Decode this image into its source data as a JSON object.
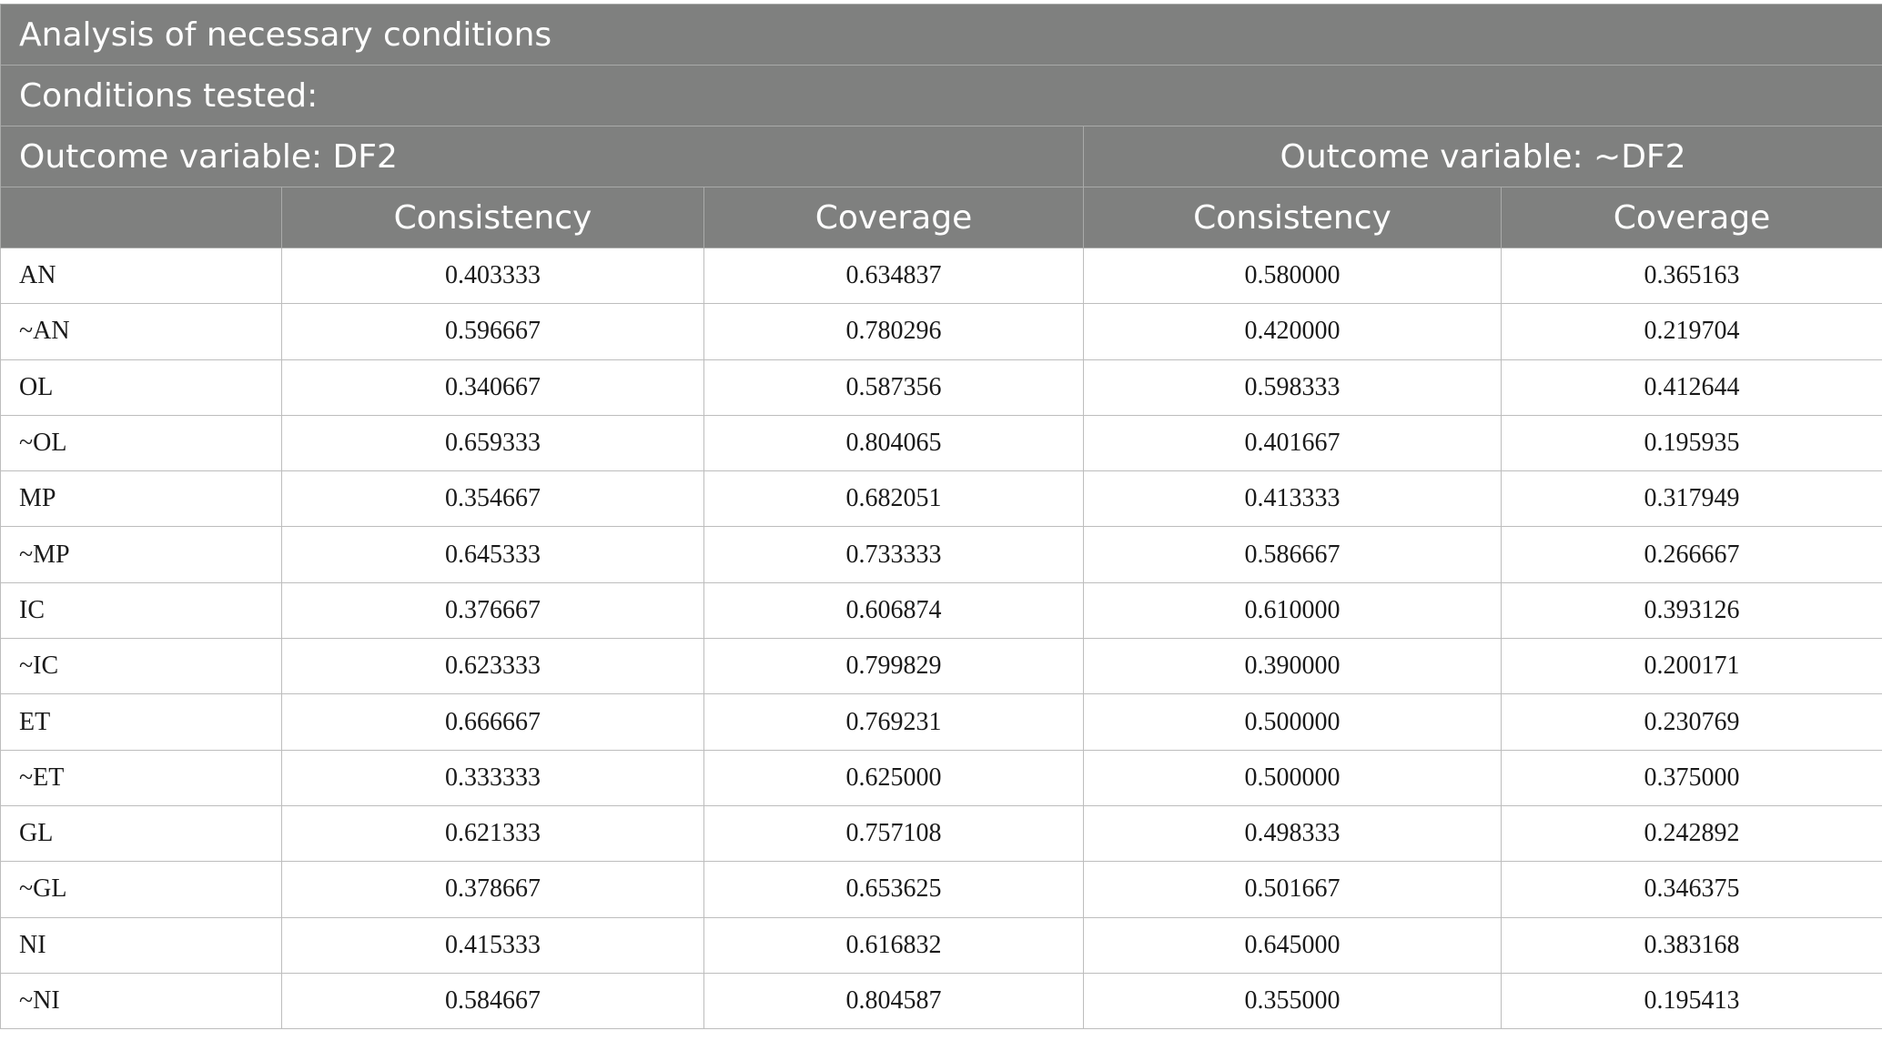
{
  "table": {
    "title": "Analysis of necessary conditions",
    "subtitle": "Conditions tested:",
    "group_headers": [
      "Outcome variable: DF2",
      "Outcome variable: ~DF2"
    ],
    "column_headers": [
      "",
      "Consistency",
      "Coverage",
      "Consistency",
      "Coverage"
    ],
    "rows": [
      [
        "AN",
        "0.403333",
        "0.634837",
        "0.580000",
        "0.365163"
      ],
      [
        "~AN",
        "0.596667",
        "0.780296",
        "0.420000",
        "0.219704"
      ],
      [
        "OL",
        "0.340667",
        "0.587356",
        "0.598333",
        "0.412644"
      ],
      [
        "~OL",
        "0.659333",
        "0.804065",
        "0.401667",
        "0.195935"
      ],
      [
        "MP",
        "0.354667",
        "0.682051",
        "0.413333",
        "0.317949"
      ],
      [
        "~MP",
        "0.645333",
        "0.733333",
        "0.586667",
        "0.266667"
      ],
      [
        "IC",
        "0.376667",
        "0.606874",
        "0.610000",
        "0.393126"
      ],
      [
        "~IC",
        "0.623333",
        "0.799829",
        "0.390000",
        "0.200171"
      ],
      [
        "ET",
        "0.666667",
        "0.769231",
        "0.500000",
        "0.230769"
      ],
      [
        "~ET",
        "0.333333",
        "0.625000",
        "0.500000",
        "0.375000"
      ],
      [
        "GL",
        "0.621333",
        "0.757108",
        "0.498333",
        "0.242892"
      ],
      [
        "~GL",
        "0.378667",
        "0.653625",
        "0.501667",
        "0.346375"
      ],
      [
        "NI",
        "0.415333",
        "0.616832",
        "0.645000",
        "0.383168"
      ],
      [
        "~NI",
        "0.584667",
        "0.804587",
        "0.355000",
        "0.195413"
      ]
    ]
  },
  "colors": {
    "header_bg": "#7f807f",
    "header_text": "#ffffff",
    "body_text": "#1a1a1a",
    "grid": "#bdbdbd"
  }
}
